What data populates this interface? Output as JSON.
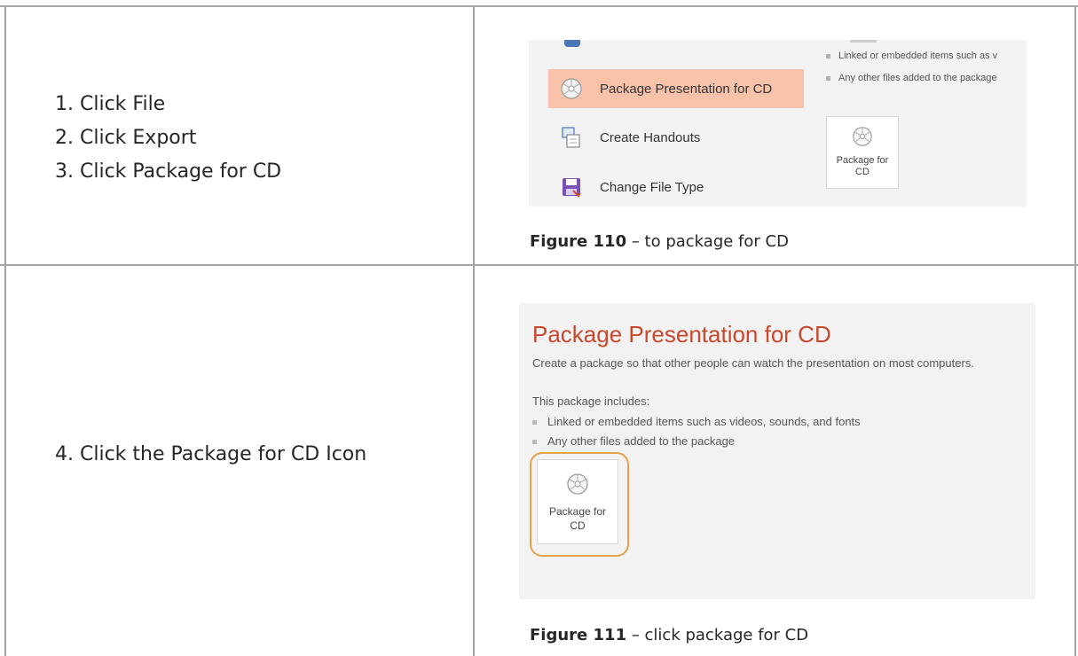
{
  "row1": {
    "steps": [
      "1. Click File",
      "2. Click Export",
      "3. Click Package for CD"
    ],
    "figure": {
      "menu_items": [
        {
          "label": "Package Presentation for CD",
          "icon": "cd-icon",
          "selected": true
        },
        {
          "label": "Create Handouts",
          "icon": "handouts-icon",
          "selected": false
        },
        {
          "label": "Change File Type",
          "icon": "save-icon",
          "selected": false
        }
      ],
      "bullets": [
        "Linked or embedded items such as v",
        "Any other files added to the package"
      ],
      "tile_label_1": "Package for",
      "tile_label_2": "CD",
      "selected_color": "#f9c3aa"
    },
    "caption_bold": "Figure 110",
    "caption_text": " – to package for CD"
  },
  "row2": {
    "step": "4. Click the Package for CD Icon",
    "figure": {
      "title": "Package Presentation for CD",
      "subtitle": "Create a package so that other people can watch the presentation on most computers.",
      "includes_label": "This package includes:",
      "bullets": [
        "Linked or embedded items such as videos, sounds, and fonts",
        "Any other files added to the package"
      ],
      "tile_label_1": "Package for",
      "tile_label_2": "CD",
      "title_color": "#c8472d",
      "highlight_color": "#e8a24a"
    },
    "caption_bold": "Figure 111",
    "caption_text": " – click package for CD"
  }
}
